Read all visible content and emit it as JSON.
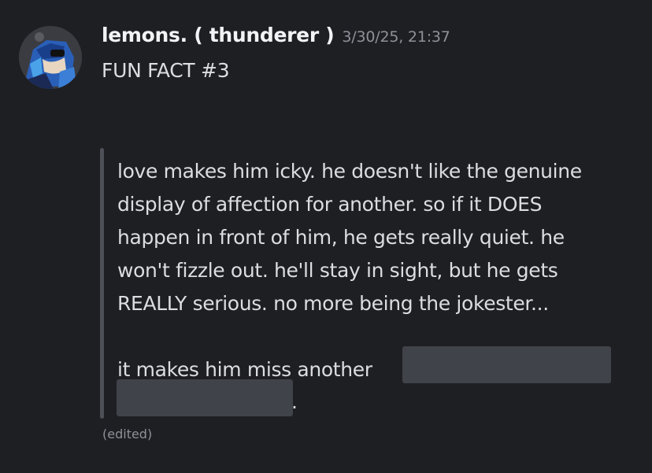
{
  "message": {
    "author": "lemons. ( thunderer )",
    "timestamp": "3/30/25, 21:37",
    "first_line": "FUN FACT #3",
    "quote_lines": [
      "love makes him icky. he doesn't like the genuine",
      "display of affection for another. so if it DOES",
      "happen in front of him, he gets really quiet. he",
      "won't fizzle out. he'll stay in sight, but he gets",
      "REALLY serious. no more being the jokester..."
    ],
    "last_line_text": "it makes him miss another",
    "trailing_punct": ".",
    "edited_label": "(edited)"
  },
  "icons": {
    "avatar": "avatar-character-icon"
  },
  "colors": {
    "background": "#1e1f23",
    "username": "#f2f3f5",
    "text": "#dbdee1",
    "muted": "#8e9199",
    "quote_bar": "#4e5058",
    "spoiler": "#41434a"
  }
}
